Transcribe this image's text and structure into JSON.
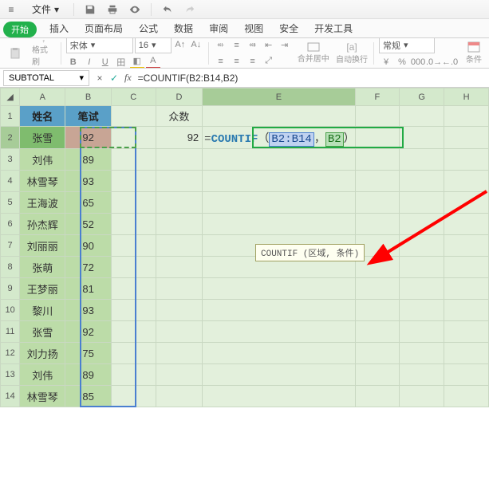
{
  "qat": {
    "file": "文件",
    "dropdown": "▾"
  },
  "tabs": {
    "start": "开始",
    "items": [
      "插入",
      "页面布局",
      "公式",
      "数据",
      "审阅",
      "视图",
      "安全",
      "开发工具"
    ]
  },
  "ribbon": {
    "format_brush": "格式刷",
    "font": "宋体",
    "size": "16",
    "merge": "合并居中",
    "wrap": "自动换行",
    "numfmt": "常规",
    "cond": "条件"
  },
  "fbar": {
    "name": "SUBTOTAL",
    "cancel": "×",
    "confirm": "✓",
    "fx": "fx",
    "formula": "=COUNTIF(B2:B14,B2)"
  },
  "cols": [
    "A",
    "B",
    "C",
    "D",
    "E",
    "F",
    "G",
    "H"
  ],
  "header": {
    "name": "姓名",
    "score": "笔试",
    "mode": "众数"
  },
  "rows": [
    {
      "n": "张雪",
      "s": "92"
    },
    {
      "n": "刘伟",
      "s": "89"
    },
    {
      "n": "林雪琴",
      "s": "93"
    },
    {
      "n": "王海波",
      "s": "65"
    },
    {
      "n": "孙杰辉",
      "s": "52"
    },
    {
      "n": "刘丽丽",
      "s": "90"
    },
    {
      "n": "张萌",
      "s": "72"
    },
    {
      "n": "王梦丽",
      "s": "81"
    },
    {
      "n": "黎川",
      "s": "93"
    },
    {
      "n": "张雪",
      "s": "92"
    },
    {
      "n": "刘力扬",
      "s": "75"
    },
    {
      "n": "刘伟",
      "s": "89"
    },
    {
      "n": "林雪琴",
      "s": "85"
    }
  ],
  "d2": "92",
  "formula_parts": {
    "fn": "COUNTIF",
    "open": "（",
    "arg1": "B2:B14",
    "sep": "，",
    "arg2": "B2",
    "close": "）"
  },
  "tooltip": "COUNTIF (区域, 条件)",
  "chart_data": {
    "type": "table",
    "title": "",
    "columns": [
      "姓名",
      "笔试"
    ],
    "rows": [
      [
        "张雪",
        92
      ],
      [
        "刘伟",
        89
      ],
      [
        "林雪琴",
        93
      ],
      [
        "王海波",
        65
      ],
      [
        "孙杰辉",
        52
      ],
      [
        "刘丽丽",
        90
      ],
      [
        "张萌",
        72
      ],
      [
        "王梦丽",
        81
      ],
      [
        "黎川",
        93
      ],
      [
        "张雪",
        92
      ],
      [
        "刘力扬",
        75
      ],
      [
        "刘伟",
        89
      ],
      [
        "林雪琴",
        85
      ]
    ],
    "mode_label": "众数",
    "mode_value": 92,
    "formula_cell": "E2",
    "formula": "=COUNTIF(B2:B14,B2)"
  }
}
